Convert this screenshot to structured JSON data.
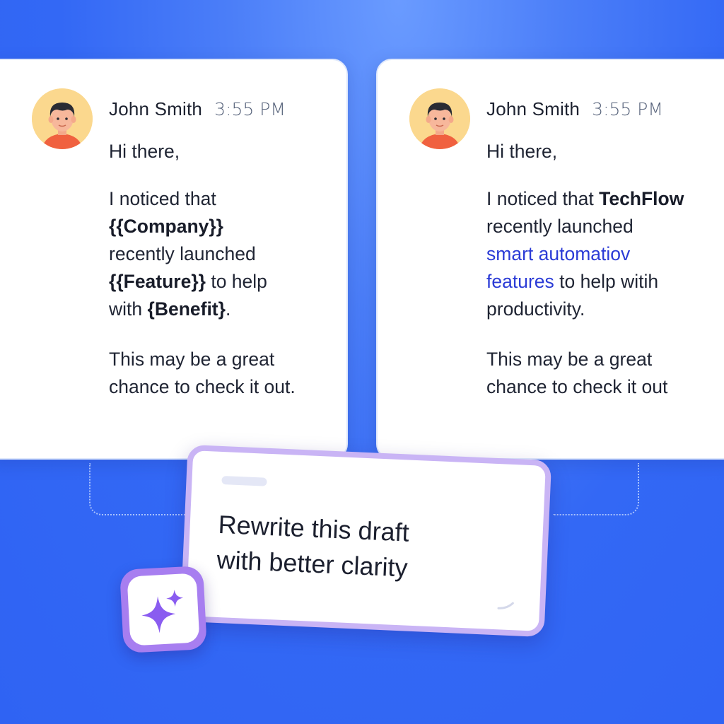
{
  "messages": {
    "left": {
      "sender": "John Smith",
      "time": "3:55 PM",
      "greeting": "Hi there,",
      "line1": "I noticed that",
      "company": "{{Company}}",
      "line2": "recently launched",
      "feature": "{{Feature}}",
      "line3": " to help",
      "line4": "with ",
      "benefit": "{Benefit}",
      "line5": ".",
      "closing": "This may be a great chance to check it out."
    },
    "right": {
      "sender": "John Smith",
      "time": "3:55 PM",
      "greeting": "Hi there,",
      "line1": "I noticed that ",
      "company": "TechFlow",
      "line2": "recently launched",
      "feature1": "smart automatiov",
      "feature2": "features",
      "line3": " to help witih",
      "line4": "productivity.",
      "closing1": "This may be a great",
      "closing2": "chance to check it out"
    }
  },
  "prompt": {
    "line1": "Rewrite this draft",
    "line2": "with better clarity"
  },
  "colors": {
    "background": "#3368f5",
    "link": "#2b3bd6",
    "prompt_border": "#c9b4f5",
    "sparkle": "#8a5cf0",
    "avatar_bg": "#fbd88e"
  },
  "icons": {
    "avatar": "person-avatar-icon",
    "sparkle": "ai-sparkle-icon"
  }
}
